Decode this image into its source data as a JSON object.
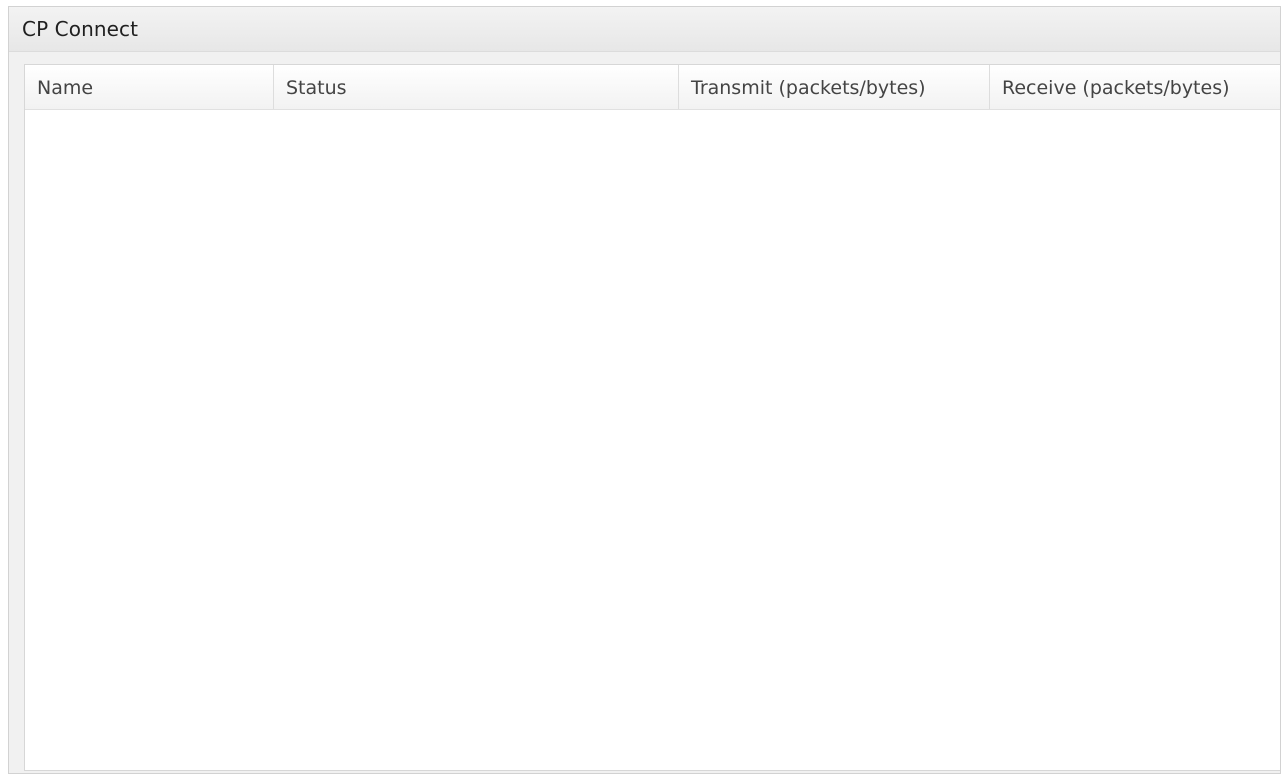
{
  "panel": {
    "title": "CP Connect"
  },
  "table": {
    "columns": [
      {
        "label": "Name"
      },
      {
        "label": "Status"
      },
      {
        "label": "Transmit (packets/bytes)"
      },
      {
        "label": "Receive (packets/bytes)"
      }
    ],
    "rows": []
  },
  "colors": {
    "panel_background": "#f1f1f1",
    "header_text": "#444444",
    "title_text": "#1f1f1f",
    "grid_background": "#ffffff",
    "border": "#d7d7d7"
  }
}
